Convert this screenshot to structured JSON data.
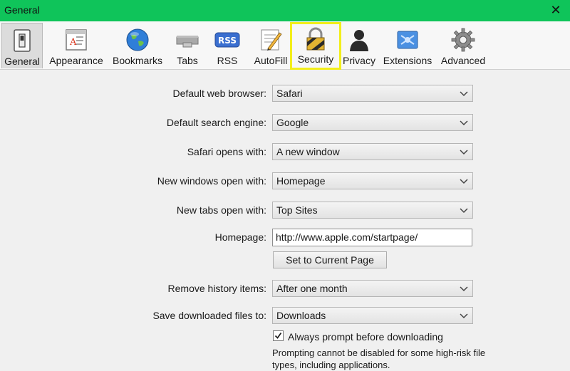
{
  "window": {
    "title": "General"
  },
  "toolbar": {
    "items": [
      {
        "id": "general",
        "label": "General",
        "icon": "switch-icon",
        "active": true
      },
      {
        "id": "appearance",
        "label": "Appearance",
        "icon": "appearance-icon"
      },
      {
        "id": "bookmarks",
        "label": "Bookmarks",
        "icon": "globe-icon"
      },
      {
        "id": "tabs",
        "label": "Tabs",
        "icon": "tabs-icon"
      },
      {
        "id": "rss",
        "label": "RSS",
        "icon": "rss-icon",
        "badge": "RSS"
      },
      {
        "id": "autofill",
        "label": "AutoFill",
        "icon": "pencil-icon"
      },
      {
        "id": "security",
        "label": "Security",
        "icon": "lock-icon",
        "highlighted": true
      },
      {
        "id": "privacy",
        "label": "Privacy",
        "icon": "person-icon"
      },
      {
        "id": "extensions",
        "label": "Extensions",
        "icon": "puzzle-icon"
      },
      {
        "id": "advanced",
        "label": "Advanced",
        "icon": "gear-icon"
      }
    ],
    "highlight_color": "#f2ee1a"
  },
  "form": {
    "default_browser": {
      "label": "Default web browser:",
      "value": "Safari"
    },
    "search_engine": {
      "label": "Default search engine:",
      "value": "Google"
    },
    "safari_opens_with": {
      "label": "Safari opens with:",
      "value": "A new window"
    },
    "new_windows": {
      "label": "New windows open with:",
      "value": "Homepage"
    },
    "new_tabs": {
      "label": "New tabs open with:",
      "value": "Top Sites"
    },
    "homepage": {
      "label": "Homepage:",
      "value": "http://www.apple.com/startpage/"
    },
    "set_current_page": "Set to Current Page",
    "remove_history": {
      "label": "Remove history items:",
      "value": "After one month"
    },
    "save_downloads": {
      "label": "Save downloaded files to:",
      "value": "Downloads"
    },
    "always_prompt": {
      "label": "Always prompt before downloading",
      "checked": true
    },
    "note": "Prompting cannot be disabled for some high-risk file types, including applications."
  },
  "colors": {
    "titlebar": "#0fc45a",
    "background": "#f0f0f0"
  }
}
